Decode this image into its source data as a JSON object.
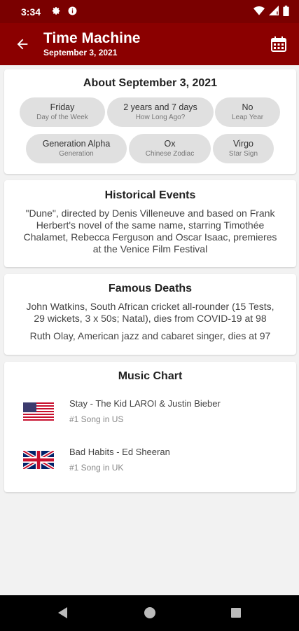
{
  "status": {
    "time": "3:34"
  },
  "app_bar": {
    "title": "Time Machine",
    "subtitle": "September 3, 2021"
  },
  "about": {
    "title": "About September 3, 2021",
    "chips": [
      {
        "value": "Friday",
        "label": "Day of the Week"
      },
      {
        "value": "2 years and 7 days",
        "label": "How Long Ago?"
      },
      {
        "value": "No",
        "label": "Leap Year"
      },
      {
        "value": "Generation Alpha",
        "label": "Generation"
      },
      {
        "value": "Ox",
        "label": "Chinese Zodiac"
      },
      {
        "value": "Virgo",
        "label": "Star Sign"
      }
    ]
  },
  "historical_events": {
    "title": "Historical Events",
    "lines": [
      "\"Dune\", directed by Denis Villeneuve and based on Frank",
      "Herbert's novel of the same name, starring Timothée",
      "Chalamet, Rebecca Ferguson and Oscar Isaac, premieres",
      "at the Venice Film Festival"
    ]
  },
  "famous_deaths": {
    "title": "Famous Deaths",
    "items": [
      {
        "lines": [
          "John Watkins, South African cricket all-rounder (15 Tests,",
          "29 wickets, 3 x 50s; Natal), dies from COVID-19 at 98"
        ]
      },
      {
        "lines": [
          "Ruth Olay, American jazz and cabaret singer, dies at 97"
        ]
      }
    ]
  },
  "music_chart": {
    "title": "Music Chart",
    "entries": [
      {
        "song": "Stay - The Kid LAROI & Justin Bieber",
        "rank": "#1 Song in US",
        "flag": "us-flag-icon"
      },
      {
        "song": "Bad Habits - Ed Sheeran",
        "rank": "#1 Song in UK",
        "flag": "uk-flag-icon"
      }
    ]
  },
  "colors": {
    "app_bar": "#8b0000",
    "status_bar": "#7a0000",
    "chip": "#e0e0e0"
  }
}
